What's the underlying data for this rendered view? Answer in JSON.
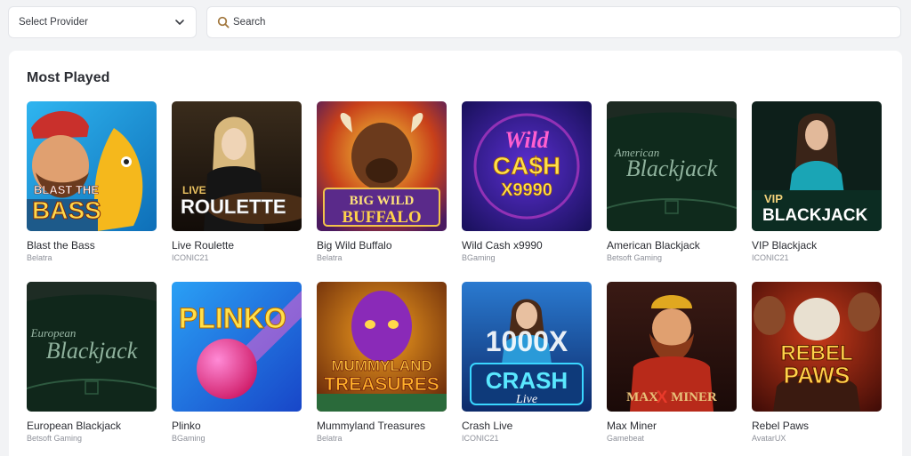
{
  "filters": {
    "provider_label": "Select Provider",
    "search_placeholder": "Search"
  },
  "section": {
    "title": "Most Played"
  },
  "games": [
    {
      "name": "Blast the Bass",
      "provider": "Belatra",
      "art_lines": [
        "BLAST THE",
        "BASS"
      ],
      "icon": "fish-icon"
    },
    {
      "name": "Live Roulette",
      "provider": "ICONIC21",
      "art_lines": [
        "LIVE",
        "ROULETTE"
      ],
      "icon": "roulette-icon"
    },
    {
      "name": "Big Wild Buffalo",
      "provider": "Belatra",
      "art_lines": [
        "BIG WILD",
        "BUFFALO"
      ],
      "icon": "buffalo-icon"
    },
    {
      "name": "Wild Cash x9990",
      "provider": "BGaming",
      "art_lines": [
        "Wild",
        "CA$H",
        "X9990"
      ],
      "icon": "cash-icon"
    },
    {
      "name": "American Blackjack",
      "provider": "Betsoft Gaming",
      "art_lines": [
        "American",
        "Blackjack"
      ],
      "icon": "card-table-icon"
    },
    {
      "name": "VIP Blackjack",
      "provider": "ICONIC21",
      "art_lines": [
        "VIP",
        "BLACKJACK"
      ],
      "icon": "dealer-icon"
    },
    {
      "name": "European Blackjack",
      "provider": "Betsoft Gaming",
      "art_lines": [
        "European",
        "Blackjack"
      ],
      "icon": "card-table-icon"
    },
    {
      "name": "Plinko",
      "provider": "BGaming",
      "art_lines": [
        "PLINKO"
      ],
      "icon": "ball-icon"
    },
    {
      "name": "Mummyland Treasures",
      "provider": "Belatra",
      "art_lines": [
        "MUMMYLAND",
        "TREASURES"
      ],
      "icon": "mummy-icon"
    },
    {
      "name": "Crash Live",
      "provider": "ICONIC21",
      "art_lines": [
        "1000X",
        "CRASH",
        "Live"
      ],
      "icon": "rocket-icon"
    },
    {
      "name": "Max Miner",
      "provider": "Gamebeat",
      "art_lines": [
        "MAX",
        "X",
        "MINER"
      ],
      "icon": "miner-icon"
    },
    {
      "name": "Rebel Paws",
      "provider": "AvatarUX",
      "art_lines": [
        "REBEL",
        "PAWS"
      ],
      "icon": "dog-icon"
    }
  ]
}
